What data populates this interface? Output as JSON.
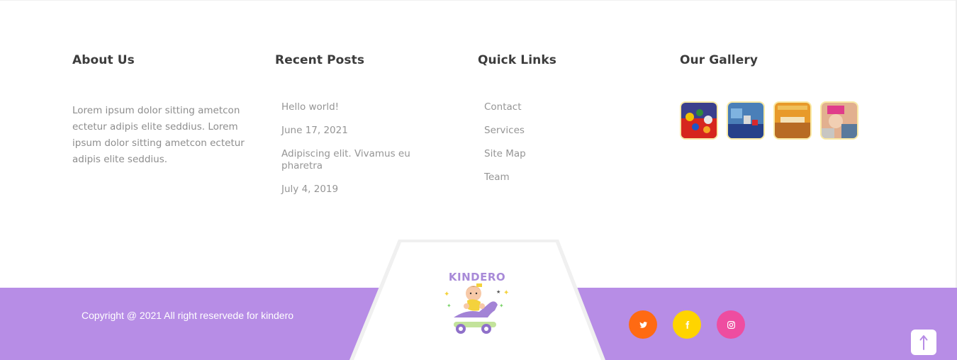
{
  "about": {
    "title": "About Us",
    "text": "Lorem ipsum dolor sitting ametcon ectetur adipis elite seddius. Lorem ipsum dolor sitting ametcon ectetur adipis elite seddius."
  },
  "recent_posts": {
    "title": "Recent Posts",
    "items": [
      "Hello world!",
      "June 17, 2021",
      "Adipiscing elit. Vivamus eu pharetra",
      "July 4, 2019"
    ]
  },
  "quick_links": {
    "title": "Quick Links",
    "items": [
      "Contact",
      "Services",
      "Site Map",
      "Team"
    ]
  },
  "gallery": {
    "title": "Our Gallery",
    "images": [
      "gallery-image-1",
      "gallery-image-2",
      "gallery-image-3",
      "gallery-image-4"
    ]
  },
  "footer": {
    "copyright": "Copyright @ 2021 All right reservede for kindero",
    "logo_text": "KINDERO",
    "bar_color": "#b78de6"
  },
  "social": [
    {
      "name": "twitter-icon",
      "color": "#ff6a13"
    },
    {
      "name": "facebook-icon",
      "color": "#ffd400"
    },
    {
      "name": "instagram-icon",
      "color": "#ee4da0"
    }
  ],
  "scroll_top": {
    "icon": "arrow-up-icon"
  }
}
